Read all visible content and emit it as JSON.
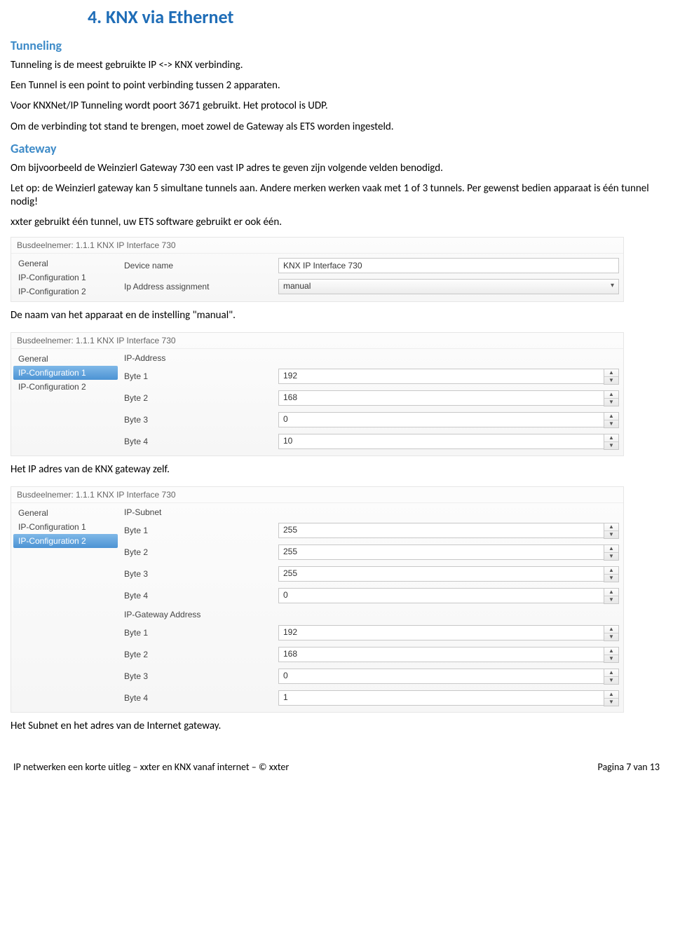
{
  "headings": {
    "h1": "4. KNX via Ethernet",
    "tunneling": "Tunneling",
    "gateway": "Gateway"
  },
  "paragraphs": {
    "p1": "Tunneling is de meest gebruikte IP <-> KNX verbinding.",
    "p2": "Een Tunnel is een point to point verbinding tussen 2 apparaten.",
    "p3": "Voor KNXNet/IP Tunneling wordt poort 3671 gebruikt. Het protocol is UDP.",
    "p4": "Om de verbinding tot stand te brengen, moet zowel de Gateway als ETS worden ingesteld.",
    "p5": "Om bijvoorbeeld de Weinzierl Gateway 730 een vast IP adres te geven zijn volgende velden benodigd.",
    "p6": "Let op: de Weinzierl gateway kan 5 simultane tunnels aan. Andere merken werken vaak met 1 of 3 tunnels. Per gewenst bedien apparaat is één tunnel nodig!",
    "p7": "xxter gebruikt één tunnel, uw ETS software gebruikt er ook één.",
    "cap1": "De naam van het apparaat en de instelling \"manual\".",
    "cap2": "Het IP adres van de KNX gateway zelf.",
    "cap3": "Het Subnet en het adres van de Internet gateway."
  },
  "panelCommon": {
    "title": "Busdeelnemer: 1.1.1  KNX IP Interface 730",
    "sidebar": {
      "general": "General",
      "ipc1": "IP-Configuration 1",
      "ipc2": "IP-Configuration 2"
    }
  },
  "panel1": {
    "labels": {
      "deviceName": "Device name",
      "ipAssign": "Ip Address assignment"
    },
    "values": {
      "deviceName": "KNX IP Interface 730",
      "ipAssign": "manual"
    }
  },
  "panel2": {
    "labels": {
      "ipaddr": "IP-Address",
      "b1": "Byte 1",
      "b2": "Byte 2",
      "b3": "Byte 3",
      "b4": "Byte 4"
    },
    "values": {
      "b1": "192",
      "b2": "168",
      "b3": "0",
      "b4": "10"
    }
  },
  "panel3": {
    "labels": {
      "subnet": "IP-Subnet",
      "b1": "Byte 1",
      "b2": "Byte 2",
      "b3": "Byte 3",
      "b4": "Byte 4",
      "gwaddr": "IP-Gateway Address",
      "gb1": "Byte 1",
      "gb2": "Byte 2",
      "gb3": "Byte 3",
      "gb4": "Byte 4"
    },
    "values": {
      "b1": "255",
      "b2": "255",
      "b3": "255",
      "b4": "0",
      "gb1": "192",
      "gb2": "168",
      "gb3": "0",
      "gb4": "1"
    }
  },
  "footer": {
    "left": "IP netwerken een korte uitleg – xxter en KNX vanaf internet – © xxter",
    "right": "Pagina 7 van 13"
  }
}
